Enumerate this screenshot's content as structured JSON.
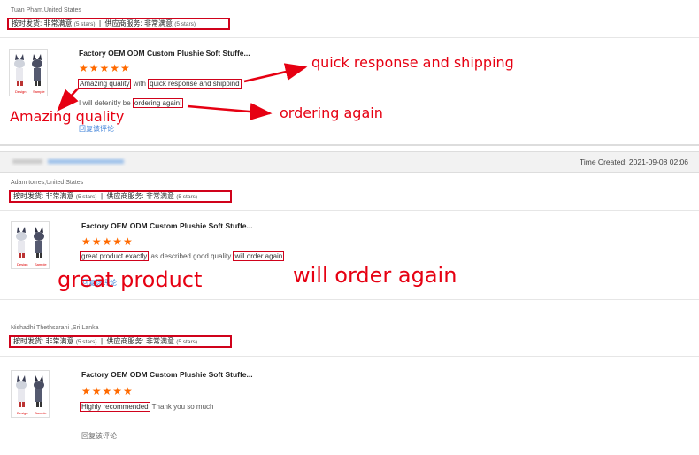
{
  "rating_label_1": "按时发货:",
  "rating_label_2": "供应商服务:",
  "rating_value": "非常满意",
  "rating_stars_text": "(5 stars)",
  "product_title": "Factory OEM ODM Custom Plushie Soft Stuffe...",
  "stars": "★★★★★",
  "reply_link": "回复该评论",
  "image_labels": {
    "design": "Design",
    "sample": "Sample"
  },
  "reviews": [
    {
      "buyer": "Tuan Pham,United States",
      "part1": "Amazing quality",
      "part2": " with ",
      "part3": "quick response and shippind",
      "line2_pre": "I will defenitly be ",
      "line2_hl": "ordering again!"
    },
    {
      "buyer": "Adam torres,United States",
      "part1": "great product exactly",
      "part2": " as described good quality ",
      "part3": "will order again"
    },
    {
      "buyer": "Nishadhi Thethsarani ,Sri Lanka",
      "part1": "Highly recommended",
      "part2": " Thank you so much"
    }
  ],
  "order_bar": {
    "time_created": "Time Created: 2021-09-08 02:06"
  },
  "annotations": {
    "a1": "quick response and shipping",
    "a2": "ordering again",
    "a3": "Amazing quality",
    "a4": "great product",
    "a5": "will order again"
  },
  "colors": {
    "annotation_red": "#e60012",
    "star_orange": "#ff6a00",
    "link_blue": "#3a7fd8"
  }
}
